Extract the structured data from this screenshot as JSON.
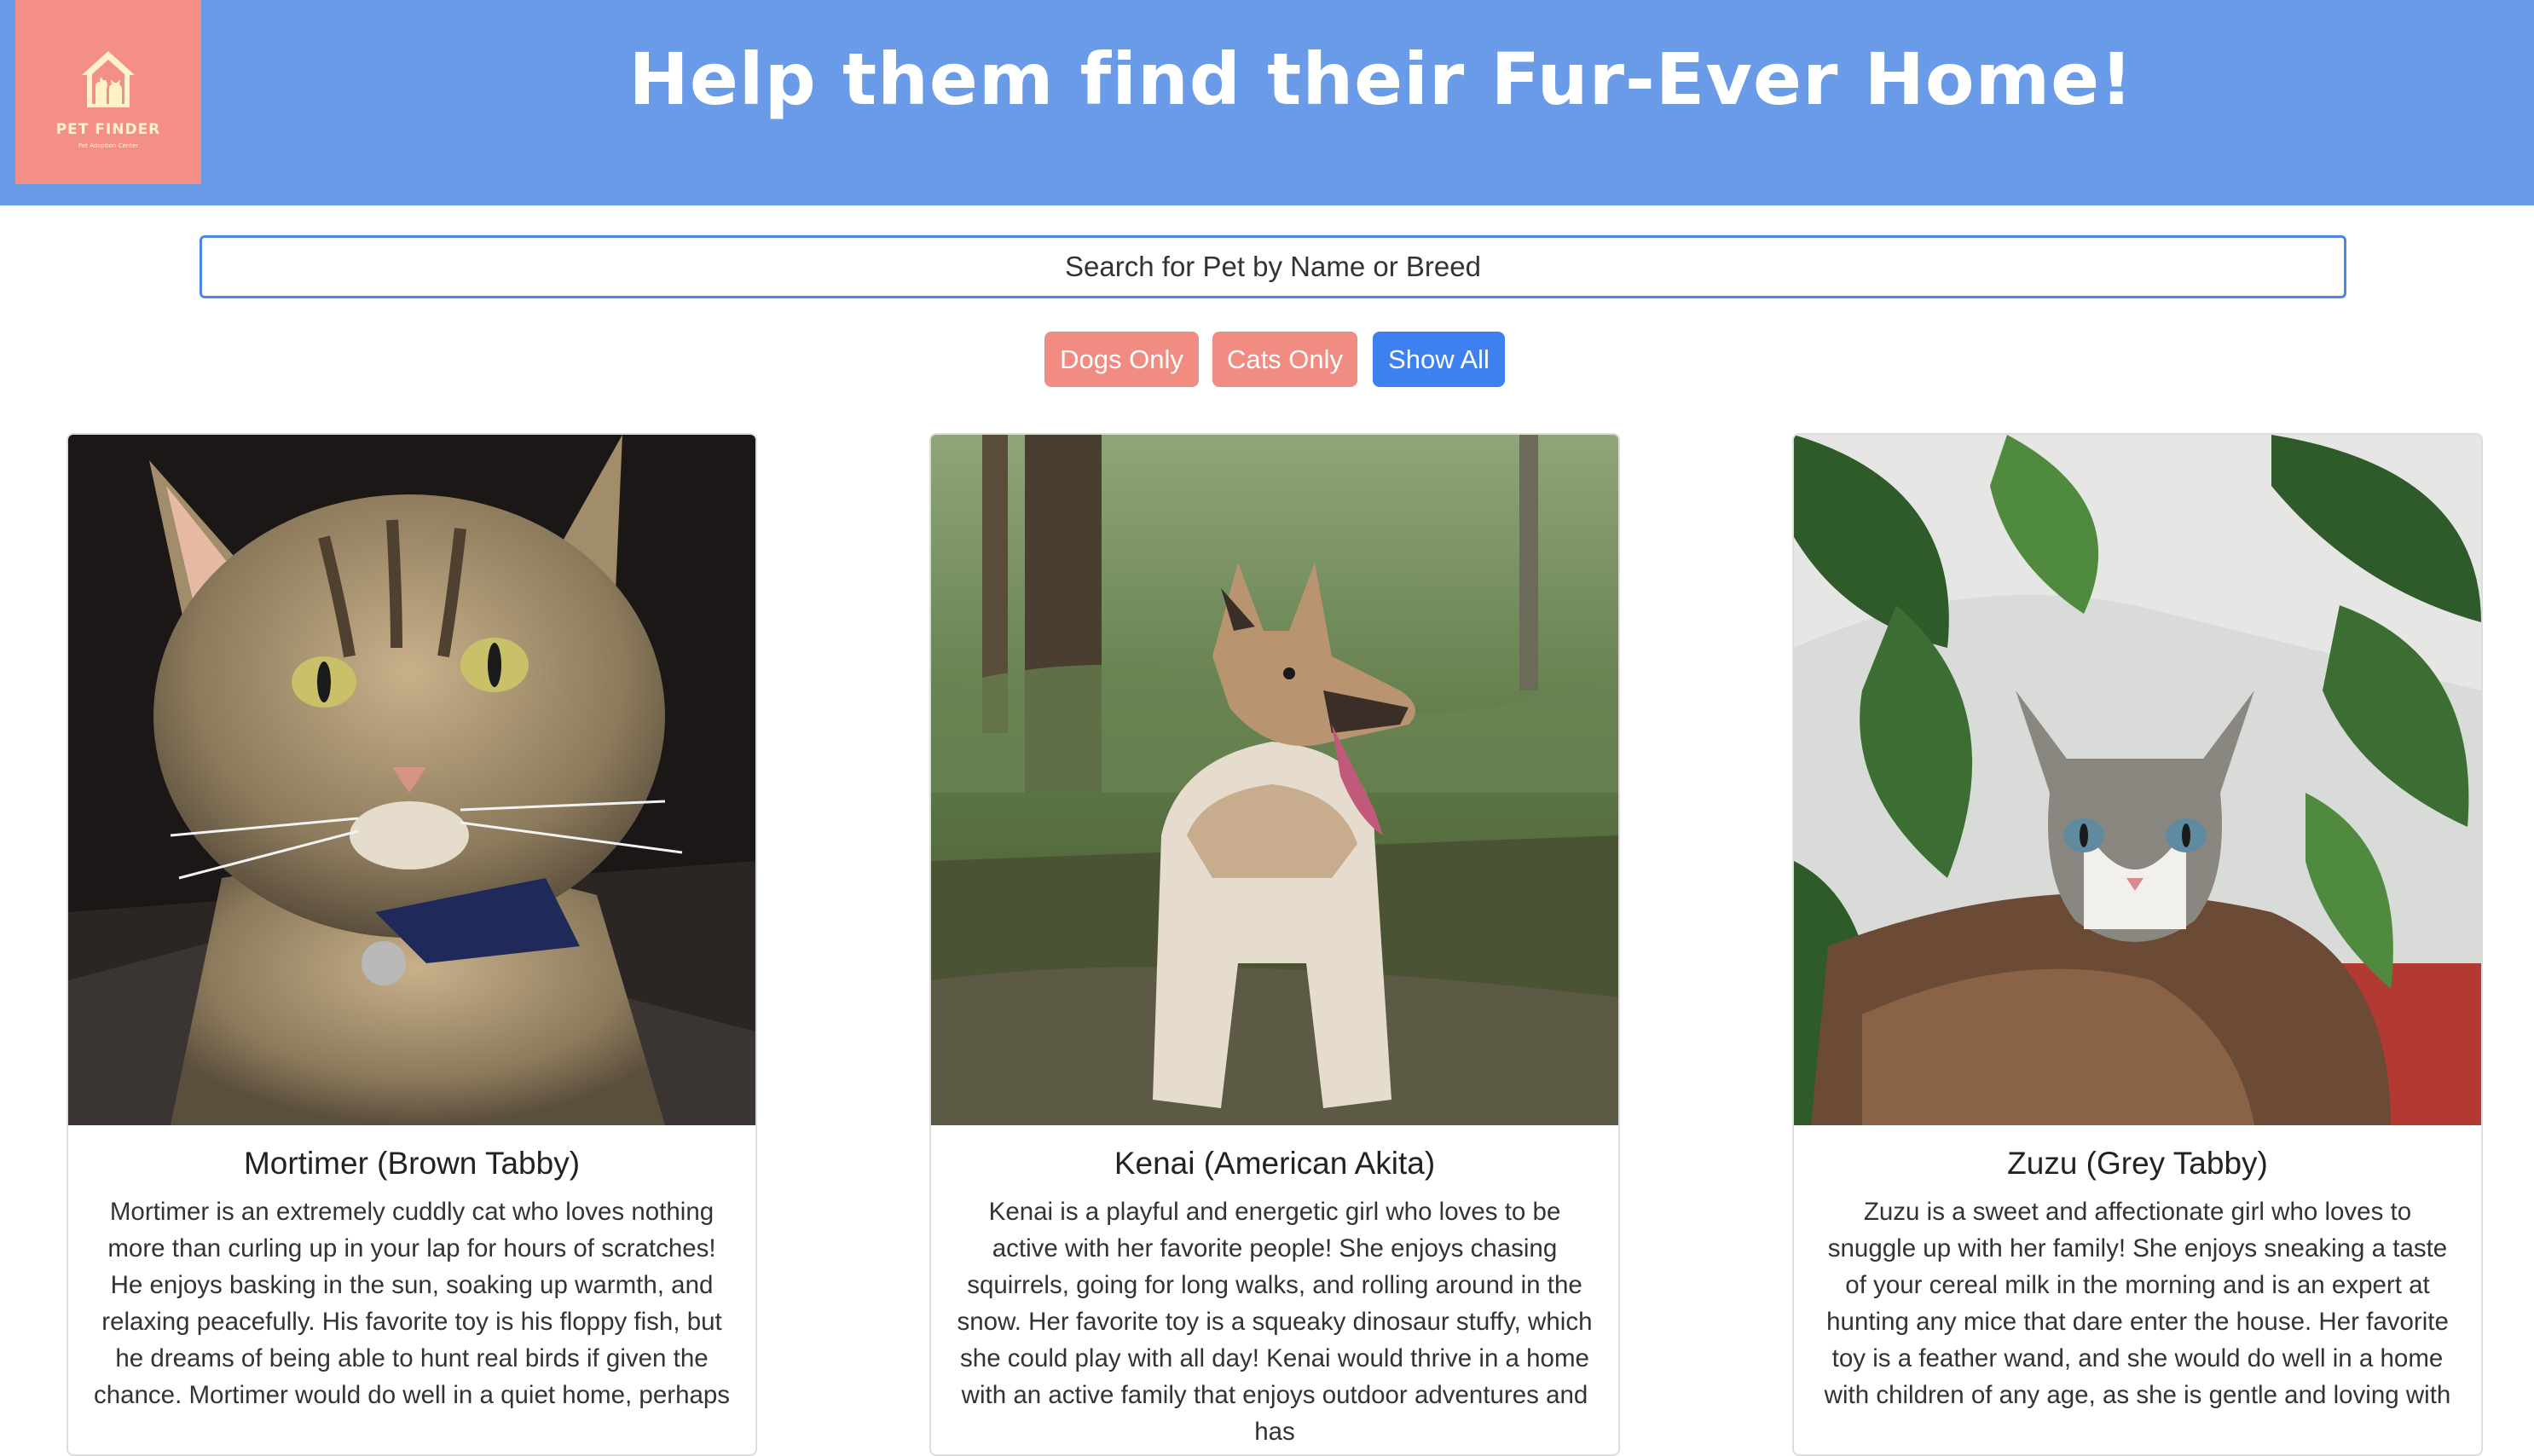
{
  "header": {
    "title": "Help them find their Fur-Ever Home!",
    "background_color": "#6A9BE8",
    "logo": {
      "name": "PET FINDER",
      "tagline": "Pet Adoption Center",
      "icon": "house-with-pets-icon",
      "background_color": "#F38F86"
    }
  },
  "search": {
    "placeholder": "Search for Pet by Name or Breed",
    "value": ""
  },
  "filters": {
    "dogs_label": "Dogs Only",
    "cats_label": "Cats Only",
    "all_label": "Show All",
    "active": "Show All",
    "accent_color": "#F08C82",
    "active_color": "#3F80F0"
  },
  "pets": [
    {
      "name": "Mortimer (Brown Tabby)",
      "description": "Mortimer is an extremely cuddly cat who loves nothing more than curling up in your lap for hours of scratches! He enjoys basking in the sun, soaking up warmth, and relaxing peacefully. His favorite toy is his floppy fish, but he dreams of being able to hunt real birds if given the chance. Mortimer would do well in a quiet home, perhaps",
      "photo": "brown-tabby-cat-photo"
    },
    {
      "name": "Kenai (American Akita)",
      "description": "Kenai is a playful and energetic girl who loves to be active with her favorite people! She enjoys chasing squirrels, going for long walks, and rolling around in the snow. Her favorite toy is a squeaky dinosaur stuffy, which she could play with all day! Kenai would thrive in a home with an active family that enjoys outdoor adventures and has",
      "photo": "akita-dog-photo"
    },
    {
      "name": "Zuzu (Grey Tabby)",
      "description": "Zuzu is a sweet and affectionate girl who loves to snuggle up with her family! She enjoys sneaking a taste of your cereal milk in the morning and is an expert at hunting any mice that dare enter the house. Her favorite toy is a feather wand, and she would do well in a home with children of any age, as she is gentle and loving with",
      "photo": "grey-tabby-cat-photo"
    }
  ]
}
